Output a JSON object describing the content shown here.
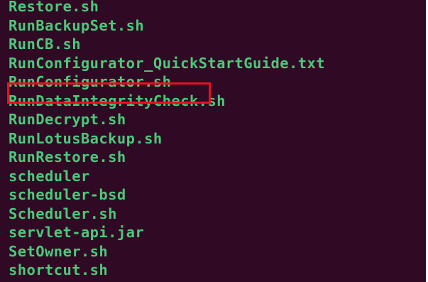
{
  "terminal": {
    "background_color": "#300a24",
    "executable_color": "#4bc97a",
    "highlight_color": "#e8101c",
    "files": [
      "Restore.sh",
      "RunBackupSet.sh",
      "RunCB.sh",
      "RunConfigurator_QuickStartGuide.txt",
      "RunConfigurator.sh",
      "RunDataIntegrityCheck.sh",
      "RunDecrypt.sh",
      "RunLotusBackup.sh",
      "RunRestore.sh",
      "scheduler",
      "scheduler-bsd",
      "Scheduler.sh",
      "servlet-api.jar",
      "SetOwner.sh",
      "shortcut.sh"
    ],
    "highlighted_file": "RunConfigurator.sh"
  }
}
